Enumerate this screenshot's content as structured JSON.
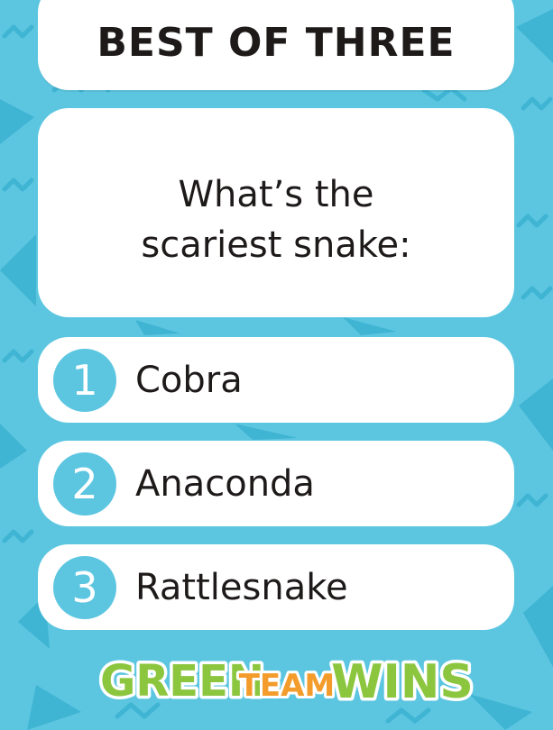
{
  "header": {
    "title": "BEST OF THREE"
  },
  "question": {
    "line1": "What’s the",
    "line2": "scariest snake:"
  },
  "options": [
    {
      "number": "1",
      "label": "Cobra"
    },
    {
      "number": "2",
      "label": "Anaconda"
    },
    {
      "number": "3",
      "label": "Rattlesnake"
    }
  ],
  "logo": {
    "word1": "GREEN",
    "word2": "TEAM",
    "word3": "WINS"
  },
  "colors": {
    "background": "#5cc6e1",
    "pattern": "#3fb4d3",
    "card": "#ffffff",
    "text": "#1e1a1a",
    "logo_green": "#8cc63f",
    "logo_orange": "#f39c2b"
  }
}
